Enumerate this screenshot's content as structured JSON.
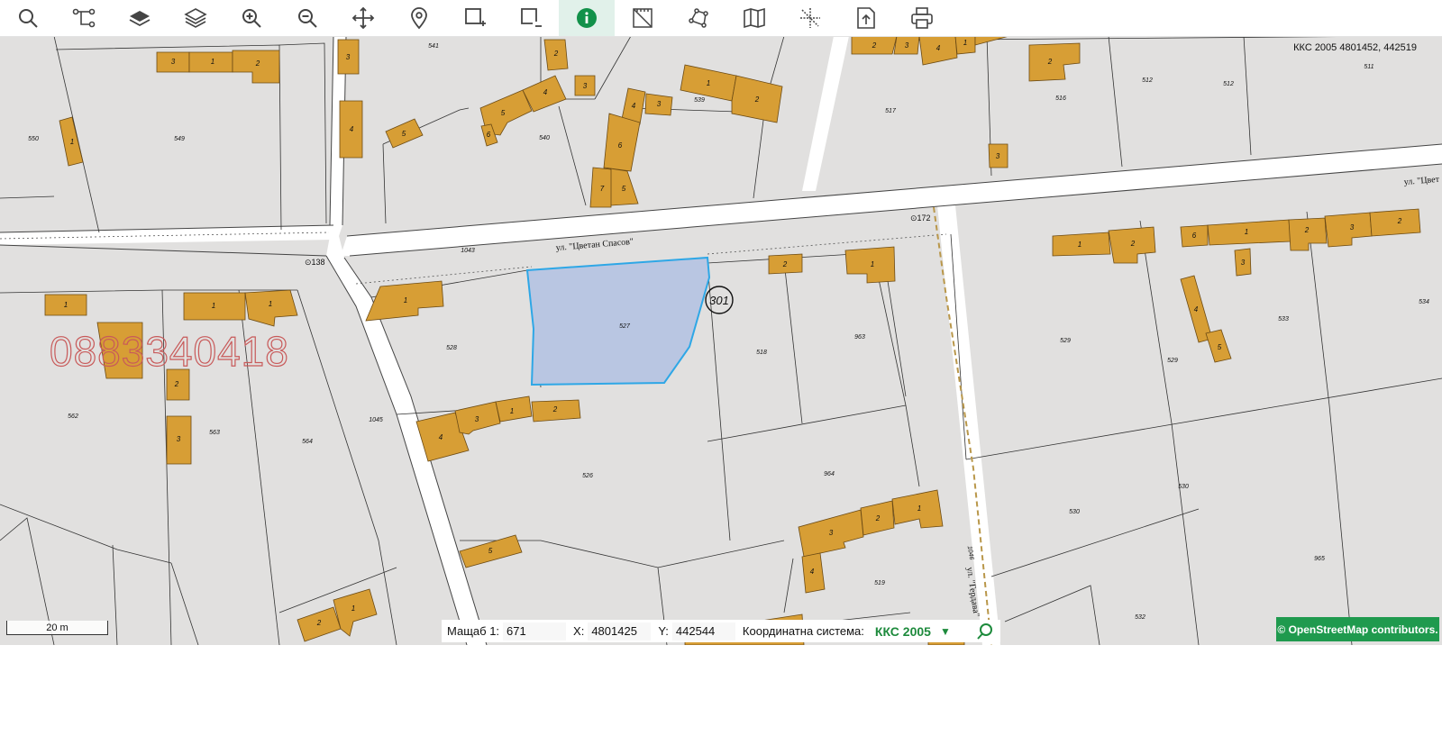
{
  "toolbar": {
    "tools": [
      {
        "name": "search-tool",
        "icon": "search-icon",
        "active": false
      },
      {
        "name": "route-tool",
        "icon": "route-icon",
        "active": false
      },
      {
        "name": "layers-tool",
        "icon": "layers-solid-icon",
        "active": false
      },
      {
        "name": "layers-outline-tool",
        "icon": "layers-outline-icon",
        "active": false
      },
      {
        "name": "zoom-in-tool",
        "icon": "zoom-in-icon",
        "active": false
      },
      {
        "name": "zoom-out-tool",
        "icon": "zoom-out-icon",
        "active": false
      },
      {
        "name": "pan-tool",
        "icon": "move-icon",
        "active": false
      },
      {
        "name": "marker-tool",
        "icon": "location-pin-icon",
        "active": false
      },
      {
        "name": "add-rect-tool",
        "icon": "rectangle-plus-icon",
        "active": false
      },
      {
        "name": "remove-rect-tool",
        "icon": "rectangle-minus-icon",
        "active": false
      },
      {
        "name": "info-tool",
        "icon": "info-icon",
        "active": true
      },
      {
        "name": "measure-tool",
        "icon": "ruler-icon",
        "active": false
      },
      {
        "name": "polygon-tool",
        "icon": "polygon-icon",
        "active": false
      },
      {
        "name": "map-tool",
        "icon": "map-icon",
        "active": false
      },
      {
        "name": "crosshair-tool",
        "icon": "crosshair-icon",
        "active": false
      },
      {
        "name": "export-tool",
        "icon": "export-icon",
        "active": false
      },
      {
        "name": "print-tool",
        "icon": "print-icon",
        "active": false
      }
    ]
  },
  "map": {
    "coords_top_right": "ККС 2005 4801452, 442519",
    "street_main": "ул. \"Цветан Спасов\"",
    "street_main_right": "ул. \"Цвет",
    "street_vertical": "ул. \"Гердава\"",
    "point_labels": [
      "⊙138",
      "⊙172"
    ],
    "parcel_circle_label": "301",
    "selected_parcel": "527",
    "parcels": [
      "541",
      "549",
      "550",
      "540",
      "539",
      "517",
      "516",
      "512",
      "512",
      "511",
      "1043",
      "528",
      "518",
      "963",
      "529",
      "529",
      "533",
      "534",
      "562",
      "563",
      "564",
      "1045",
      "526",
      "964",
      "530",
      "530",
      "965",
      "519",
      "532",
      "1046"
    ],
    "watermark_phone": "0883340418",
    "colors": {
      "background": "#e1e0df",
      "building": "#d79e35",
      "building_stroke": "#6b4a14",
      "selected_fill": "#b9c6e2",
      "selected_stroke": "#2ea7e6",
      "street": "#ffffff"
    }
  },
  "scalebar": {
    "label": "20 m"
  },
  "status": {
    "scale_label": "Мащаб 1:",
    "scale_value": "671",
    "x_label": "X:",
    "x_value": "4801425",
    "y_label": "Y:",
    "y_value": "442544",
    "crs_label": "Координатна система:",
    "crs_value": "ККС 2005"
  },
  "attribution": "© OpenStreetMap contributors."
}
